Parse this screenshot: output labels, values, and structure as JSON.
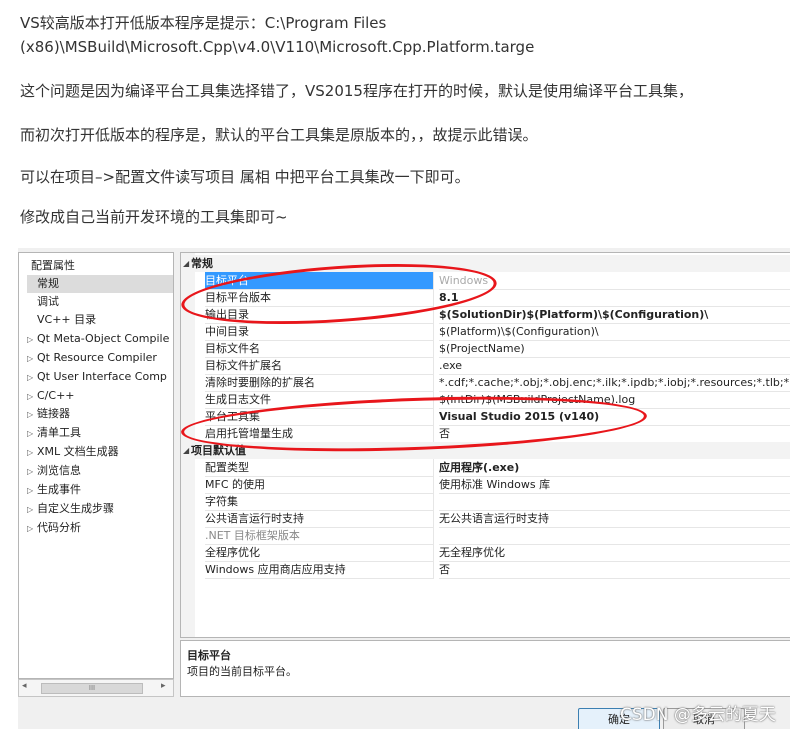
{
  "article": {
    "line1a": "VS较高版本打开低版本程序是提示：C:\\Program Files",
    "line1b": "(x86)\\MSBuild\\Microsoft.Cpp\\v4.0\\V110\\Microsoft.Cpp.Platform.targe",
    "line2": "这个问题是因为编译平台工具集选择错了，VS2015程序在打开的时候，默认是使用编译平台工具集，",
    "line3": "而初次打开低版本的程序是，默认的平台工具集是原版本的，，故提示此错误。",
    "line4": "可以在项目–>配置文件读写项目 属相 中把平台工具集改一下即可。",
    "line5": "修改成自己当前开发环境的工具集即可~"
  },
  "tree": {
    "items": [
      {
        "label": "配置属性",
        "arrow": ""
      },
      {
        "label": "常规",
        "arrow": ""
      },
      {
        "label": "调试",
        "arrow": ""
      },
      {
        "label": "VC++ 目录",
        "arrow": ""
      },
      {
        "label": "Qt Meta-Object Compile",
        "arrow": "▷"
      },
      {
        "label": "Qt Resource Compiler",
        "arrow": "▷"
      },
      {
        "label": "Qt User Interface Comp",
        "arrow": "▷"
      },
      {
        "label": "C/C++",
        "arrow": "▷"
      },
      {
        "label": "链接器",
        "arrow": "▷"
      },
      {
        "label": "清单工具",
        "arrow": "▷"
      },
      {
        "label": "XML 文档生成器",
        "arrow": "▷"
      },
      {
        "label": "浏览信息",
        "arrow": "▷"
      },
      {
        "label": "生成事件",
        "arrow": "▷"
      },
      {
        "label": "自定义生成步骤",
        "arrow": "▷"
      },
      {
        "label": "代码分析",
        "arrow": "▷"
      }
    ],
    "scroll_left": "◂",
    "scroll_thumb": "III",
    "scroll_right": "▸"
  },
  "grid": {
    "cat1": "常规",
    "cat2": "项目默认值",
    "collapse_icon": "◢",
    "rows1": [
      {
        "k": "目标平台",
        "v": "Windows"
      },
      {
        "k": "目标平台版本",
        "v": "8.1"
      },
      {
        "k": "输出目录",
        "v": "$(SolutionDir)$(Platform)\\$(Configuration)\\"
      },
      {
        "k": "中间目录",
        "v": "$(Platform)\\$(Configuration)\\"
      },
      {
        "k": "目标文件名",
        "v": "$(ProjectName)"
      },
      {
        "k": "目标文件扩展名",
        "v": ".exe"
      },
      {
        "k": "清除时要删除的扩展名",
        "v": "*.cdf;*.cache;*.obj;*.obj.enc;*.ilk;*.ipdb;*.iobj;*.resources;*.tlb;*.tli;*.t"
      },
      {
        "k": "生成日志文件",
        "v": "$(IntDir)$(MSBuildProjectName).log"
      },
      {
        "k": "平台工具集",
        "v": "Visual Studio 2015 (v140)"
      },
      {
        "k": "启用托管增量生成",
        "v": "否"
      }
    ],
    "rows2": [
      {
        "k": "配置类型",
        "v": "应用程序(.exe)"
      },
      {
        "k": "MFC 的使用",
        "v": "使用标准 Windows 库"
      },
      {
        "k": "字符集",
        "v": ""
      },
      {
        "k": "公共语言运行时支持",
        "v": "无公共语言运行时支持"
      },
      {
        "k": ".NET 目标框架版本",
        "v": ""
      },
      {
        "k": "全程序优化",
        "v": "无全程序优化"
      },
      {
        "k": "Windows 应用商店应用支持",
        "v": "否"
      }
    ]
  },
  "description": {
    "title": "目标平台",
    "text": "项目的当前目标平台。"
  },
  "buttons": {
    "ok": "确定",
    "cancel": "取消"
  },
  "watermark": "CSDN @多云的夏天",
  "colors": {
    "selection": "#3399ff",
    "annotation_red": "#e8161b"
  }
}
